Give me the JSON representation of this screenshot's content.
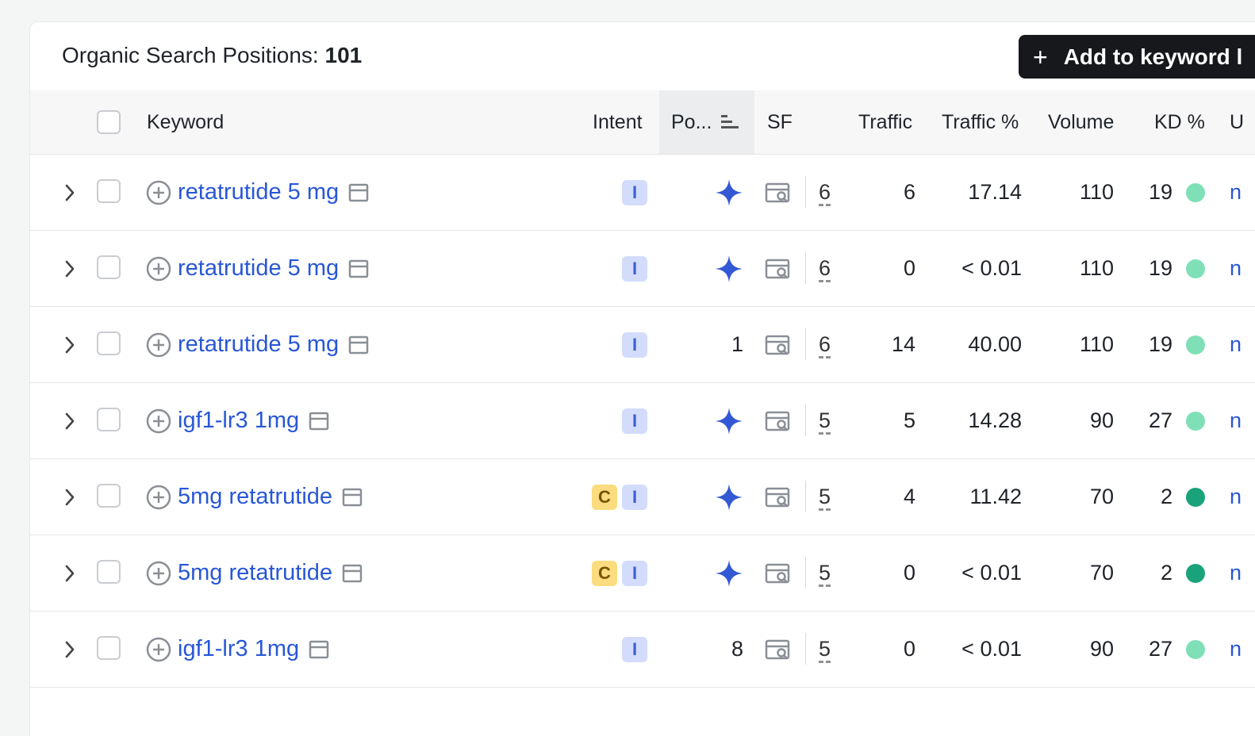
{
  "header": {
    "title_label": "Organic Search Positions:",
    "title_count": "101",
    "add_button_label": "Add to keyword l"
  },
  "columns": {
    "keyword": "Keyword",
    "intent": "Intent",
    "position": "Po...",
    "sf": "SF",
    "traffic": "Traffic",
    "traffic_pct": "Traffic %",
    "volume": "Volume",
    "kd": "KD %",
    "url": "U"
  },
  "colors": {
    "link": "#2857d6",
    "kd_light": "#7fe0b7",
    "kd_dark": "#1aa37a",
    "ai_star": "#3358d4"
  },
  "rows": [
    {
      "keyword": "retatrutide 5 mg",
      "intents": [
        "I"
      ],
      "position": "",
      "ai_overview": true,
      "sf": "6",
      "traffic": "6",
      "traffic_pct": "17.14",
      "volume": "110",
      "kd": "19",
      "kd_level": "light",
      "url": "n"
    },
    {
      "keyword": "retatrutide 5 mg",
      "intents": [
        "I"
      ],
      "position": "",
      "ai_overview": true,
      "sf": "6",
      "traffic": "0",
      "traffic_pct": "< 0.01",
      "volume": "110",
      "kd": "19",
      "kd_level": "light",
      "url": "n"
    },
    {
      "keyword": "retatrutide 5 mg",
      "intents": [
        "I"
      ],
      "position": "1",
      "ai_overview": false,
      "sf": "6",
      "traffic": "14",
      "traffic_pct": "40.00",
      "volume": "110",
      "kd": "19",
      "kd_level": "light",
      "url": "n"
    },
    {
      "keyword": "igf1-lr3 1mg",
      "intents": [
        "I"
      ],
      "position": "",
      "ai_overview": true,
      "sf": "5",
      "traffic": "5",
      "traffic_pct": "14.28",
      "volume": "90",
      "kd": "27",
      "kd_level": "light",
      "url": "n"
    },
    {
      "keyword": "5mg retatrutide",
      "intents": [
        "C",
        "I"
      ],
      "position": "",
      "ai_overview": true,
      "sf": "5",
      "traffic": "4",
      "traffic_pct": "11.42",
      "volume": "70",
      "kd": "2",
      "kd_level": "dark",
      "url": "n"
    },
    {
      "keyword": "5mg retatrutide",
      "intents": [
        "C",
        "I"
      ],
      "position": "",
      "ai_overview": true,
      "sf": "5",
      "traffic": "0",
      "traffic_pct": "< 0.01",
      "volume": "70",
      "kd": "2",
      "kd_level": "dark",
      "url": "n"
    },
    {
      "keyword": "igf1-lr3 1mg",
      "intents": [
        "I"
      ],
      "position": "8",
      "ai_overview": false,
      "sf": "5",
      "traffic": "0",
      "traffic_pct": "< 0.01",
      "volume": "90",
      "kd": "27",
      "kd_level": "light",
      "url": "n"
    }
  ]
}
